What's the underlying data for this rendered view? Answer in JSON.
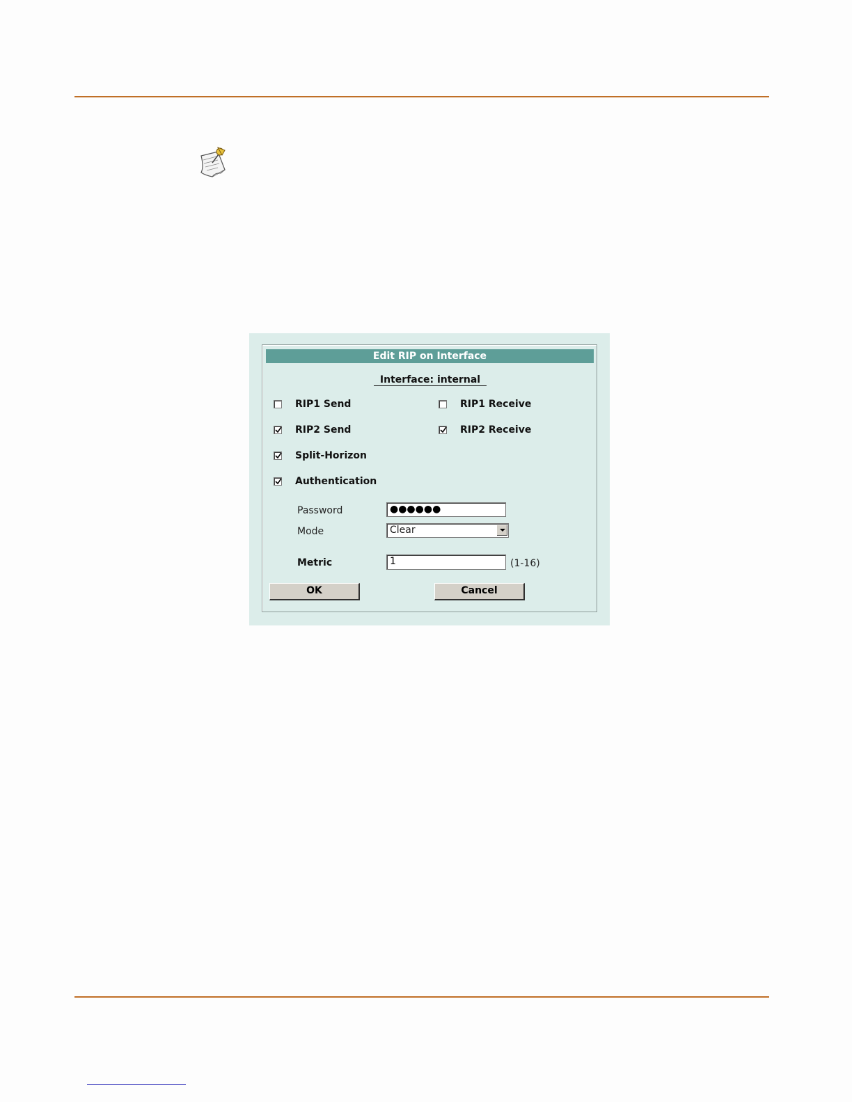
{
  "dialog": {
    "title": "Edit RIP on Interface",
    "interface_label": "Interface: internal",
    "options": {
      "rip1_send": {
        "label": "RIP1 Send",
        "checked": false
      },
      "rip1_receive": {
        "label": "RIP1 Receive",
        "checked": false
      },
      "rip2_send": {
        "label": "RIP2 Send",
        "checked": true
      },
      "rip2_receive": {
        "label": "RIP2 Receive",
        "checked": true
      },
      "split_horizon": {
        "label": "Split-Horizon",
        "checked": true
      },
      "authentication": {
        "label": "Authentication",
        "checked": true
      }
    },
    "password": {
      "label": "Password",
      "value": "●●●●●●"
    },
    "mode": {
      "label": "Mode",
      "value": "Clear"
    },
    "metric": {
      "label": "Metric",
      "value": "1",
      "hint": "(1-16)"
    },
    "ok_label": "OK",
    "cancel_label": "Cancel"
  },
  "icons": {
    "note": "note-pushpin-icon",
    "checkmark": "checkmark-icon",
    "dropdown": "chevron-down-icon"
  },
  "colors": {
    "rule": "#c06f27",
    "dialog_bg": "#dcedea",
    "title_bar": "#5e9e98",
    "button": "#d4d0c8"
  }
}
